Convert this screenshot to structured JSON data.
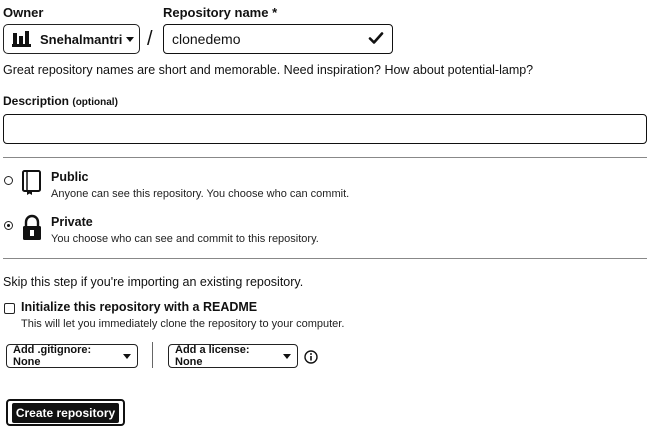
{
  "owner": {
    "label": "Owner",
    "value": "Snehalmantri"
  },
  "repo_name": {
    "label": "Repository name *",
    "value": "clonedemo"
  },
  "separator": "/",
  "hint": "Great repository names are short and memorable. Need inspiration? How about potential-lamp?",
  "description": {
    "label": "Description",
    "optional": "(optional)",
    "value": ""
  },
  "visibility": {
    "public": {
      "title": "Public",
      "desc": "Anyone can see this repository. You choose who can commit.",
      "selected": false
    },
    "private": {
      "title": "Private",
      "desc": "You choose who can see and commit to this repository.",
      "selected": true
    }
  },
  "skip_text": "Skip this step if you're importing an existing repository.",
  "readme": {
    "title": "Initialize this repository with a README",
    "desc": "This will let you immediately clone the repository to your computer.",
    "checked": false
  },
  "gitignore_button": "Add .gitignore: None",
  "license_button": "Add a license: None",
  "create_button": "Create repository",
  "icons": {
    "owner_avatar": "avatar-icon",
    "valid": "check-icon",
    "public": "repo-book-icon",
    "private": "lock-icon",
    "info": "info-icon"
  }
}
